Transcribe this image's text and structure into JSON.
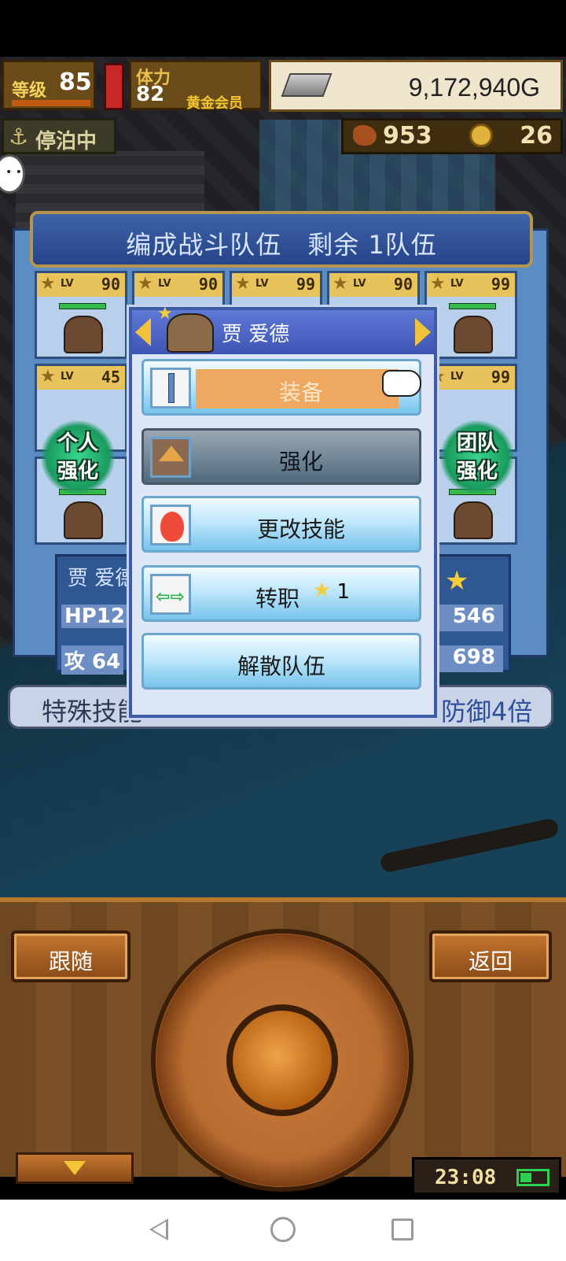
{
  "hud": {
    "level_label": "等级",
    "level_value": "85",
    "stamina_label": "体力",
    "stamina_value": "82",
    "membership": "黄金会员",
    "gold": "9,172,940G",
    "status": "停泊中",
    "food": "953",
    "coins": "26"
  },
  "team": {
    "title": "编成战斗队伍　剩余 1队伍",
    "lv_text": "LV",
    "cards_row1": [
      "90",
      "90",
      "99",
      "90",
      "99"
    ],
    "cards_row2": [
      "45",
      "99"
    ],
    "solo_boost": [
      "个人",
      "强化"
    ],
    "team_boost": [
      "团队",
      "强化"
    ]
  },
  "info": {
    "name": "贾 爱德",
    "hp_label": "HP12",
    "atk_label": "攻 64",
    "hp_right": "546",
    "atk_right": "698",
    "skill_label": "特殊技能",
    "skill_value": "防御4倍"
  },
  "popup": {
    "name": "贾 爱德",
    "menu": {
      "equip": "装备",
      "upgrade": "强化",
      "change_skill": "更改技能",
      "change_class": "转职",
      "class_cost": "1",
      "disband": "解散队伍"
    }
  },
  "controls": {
    "follow": "跟随",
    "return": "返回",
    "clock": "23:08"
  }
}
